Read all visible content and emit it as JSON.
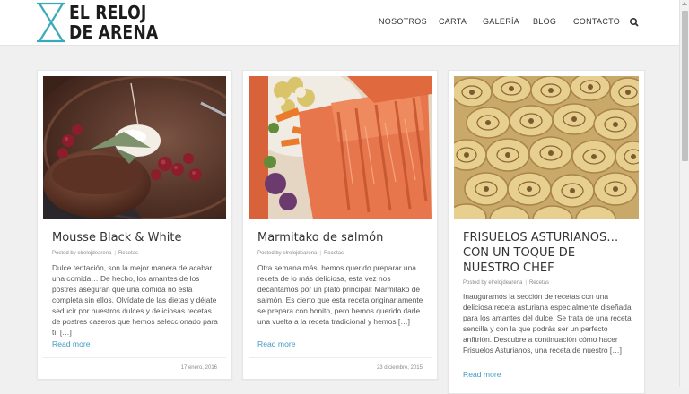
{
  "site": {
    "logo_line1": "EL RELOJ",
    "logo_line2": "DE ARENA",
    "brand_color": "#3aaaba"
  },
  "nav": {
    "items": [
      "NOSOTROS",
      "CARTA",
      "GALERÍA",
      "BLOG",
      "CONTACTO"
    ],
    "search_icon": "search-icon"
  },
  "posts": [
    {
      "title": "Mousse Black & White",
      "author": "Posted by elrelojdearena",
      "category": "Recetas",
      "excerpt": "Dulce tentación, son la mejor manera de acabar una comida… De hecho, los amantes de los postres aseguran que una comida no está completa sin ellos. Olvídate de las dietas y déjate seducir por nuestros dulces y deliciosas recetas de postres caseros que hemos seleccionado para ti. […]",
      "read_more": "Read more",
      "date": "17 enero, 2016"
    },
    {
      "title": "Marmitako de salmón",
      "author": "Posted by elrelojdearena",
      "category": "Recetas",
      "excerpt": "Otra semana más, hemos querido preparar una receta de lo más deliciosa, esta vez nos decantamos por un plato principal: Marmitako de salmón. Es cierto que esta receta originariamente se prepara con bonito, pero hemos querido darle una vuelta a la receta tradicional y hemos […]",
      "read_more": "Read more",
      "date": "23 diciembre, 2015"
    },
    {
      "title": "FRISUELOS ASTURIANOS… CON UN TOQUE DE NUESTRO CHEF",
      "author": "Posted by elrelojdearena",
      "category": "Recetas",
      "excerpt": "Inauguramos la sección de recetas con una deliciosa receta asturiana especialmente diseñada para los amantes del dulce. Se trata de una receta sencilla y con la que podrás ser un perfecto anfitrión. Descubre a continuación cómo hacer Frisuelos Asturianos, una receta de nuestro […]",
      "read_more": "Read more"
    }
  ],
  "colors": {
    "link": "#3e9bc7",
    "background": "#f0f0f0"
  }
}
